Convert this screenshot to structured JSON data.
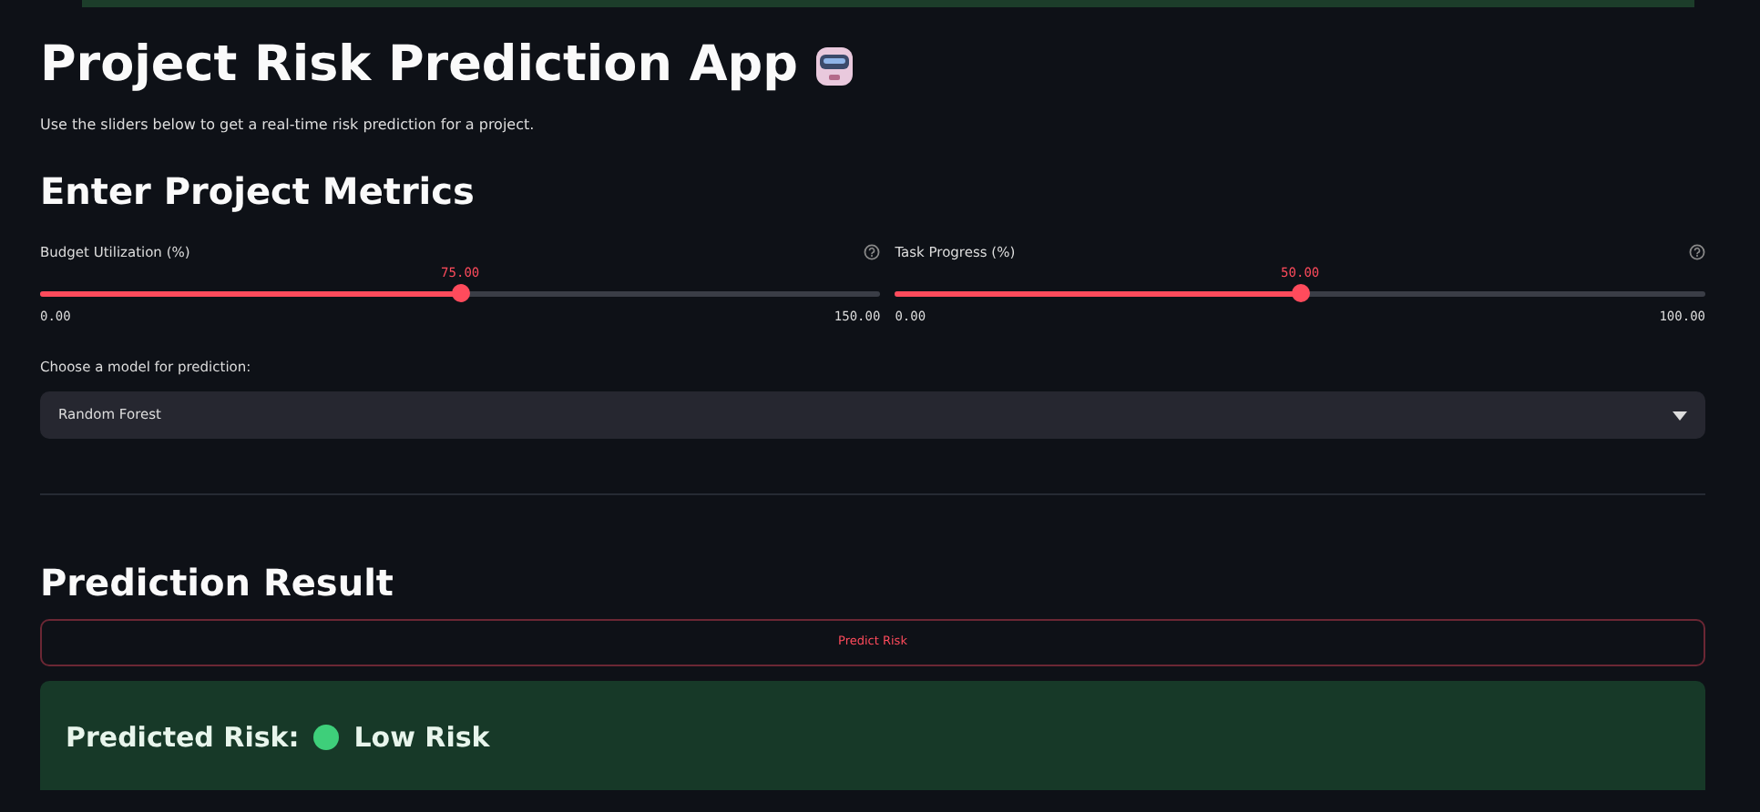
{
  "title": "Project Risk Prediction App",
  "subtitle": "Use the sliders below to get a real-time risk prediction for a project.",
  "metrics_heading": "Enter Project Metrics",
  "sliders": [
    {
      "label": "Budget Utilization (%)",
      "value": "75.00",
      "min": "0.00",
      "max": "150.00",
      "level": 0.5
    },
    {
      "label": "Task Progress (%)",
      "value": "50.00",
      "min": "0.00",
      "max": "100.00",
      "level": 0.5
    }
  ],
  "model_select": {
    "label": "Choose a model for prediction:",
    "value": "Random Forest"
  },
  "result_heading": "Prediction Result",
  "predict_button": "Predict Risk",
  "result": {
    "label": "Predicted Risk:",
    "value": "Low Risk",
    "color": "#3ecf7a"
  }
}
